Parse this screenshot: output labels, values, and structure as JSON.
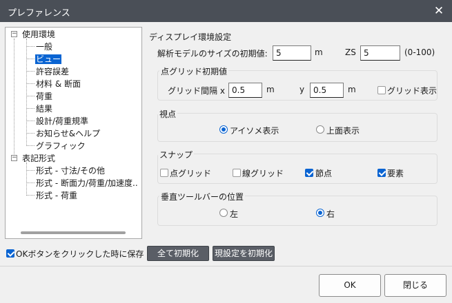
{
  "window": {
    "title": "プレファレンス",
    "close_symbol": "✕"
  },
  "tree": {
    "groups": [
      {
        "label": "使用環境",
        "expander": "−",
        "children": [
          "一般",
          "ビュー",
          "許容誤差",
          "材料 & 断面",
          "荷重",
          "結果",
          "設計/荷重規準",
          "お知らせ&ヘルプ",
          "グラフィック"
        ]
      },
      {
        "label": "表記形式",
        "expander": "−",
        "children": [
          "形式 - 寸法/その他",
          "形式 - 断面力/荷重/加速度..",
          "形式 - 荷重"
        ]
      }
    ],
    "selected": "ビュー"
  },
  "display": {
    "title": "ディスプレイ環境設定",
    "model_size_label": "解析モデルのサイズの初期値:",
    "model_size_value": "5",
    "model_size_unit": "m",
    "zs_label": "ZS",
    "zs_value": "5",
    "zs_range": "(0-100)"
  },
  "grid": {
    "title": "点グリッド初期値",
    "spacing_x_label": "グリッド間隔 x :",
    "spacing_x_value": "0.5",
    "x_unit": "m",
    "y_label": "y",
    "spacing_y_value": "0.5",
    "y_unit": "m",
    "show_grid_label": "グリッド表示",
    "show_grid": false
  },
  "viewpoint": {
    "title": "視点",
    "options": [
      "アイソメ表示",
      "上面表示"
    ],
    "selected": "アイソメ表示"
  },
  "snap": {
    "title": "スナップ",
    "options": [
      {
        "label": "点グリッド",
        "checked": false
      },
      {
        "label": "線グリッド",
        "checked": false
      },
      {
        "label": "節点",
        "checked": true
      },
      {
        "label": "要素",
        "checked": true
      }
    ]
  },
  "toolbar_position": {
    "title": "垂直ツールバーの位置",
    "options": [
      "左",
      "右"
    ],
    "selected": "右"
  },
  "save_on_ok": {
    "label": "OKボタンをクリックした時に保存",
    "checked": true
  },
  "buttons": {
    "reset_all": "全て初期化",
    "reset_current": "現設定を初期化",
    "ok": "OK",
    "close": "閉じる"
  },
  "colors": {
    "titlebar": "#4a4f57",
    "accent": "#0a64d2",
    "dark_button": "#5a5e66"
  }
}
